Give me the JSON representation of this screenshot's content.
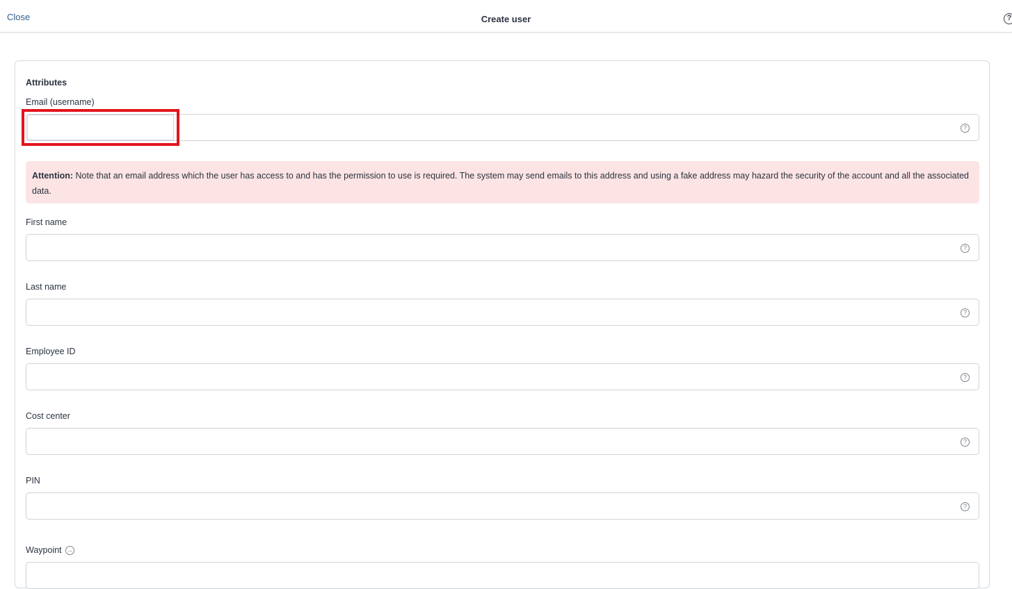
{
  "header": {
    "close_label": "Close",
    "title": "Create user",
    "help_icon": "question-circle-icon",
    "help_glyph": "?"
  },
  "form": {
    "section_title": "Attributes",
    "email": {
      "label": "Email (username)",
      "value": ""
    },
    "attention": {
      "prefix": "Attention:",
      "text": " Note that an email address which the user has access to and has the permission to use is required. The system may send emails to this address and using a fake address may hazard the security of the account and all the associated data."
    },
    "first_name": {
      "label": "First name",
      "value": ""
    },
    "last_name": {
      "label": "Last name",
      "value": ""
    },
    "employee_id": {
      "label": "Employee ID",
      "value": ""
    },
    "cost_center": {
      "label": "Cost center",
      "value": ""
    },
    "pin": {
      "label": "PIN",
      "value": ""
    },
    "waypoint": {
      "label": "Waypoint",
      "arrow_icon": "arrow-right-circle-icon",
      "arrow_glyph": "→"
    },
    "field_help_glyph": "?"
  },
  "colors": {
    "link": "#2f5d8a",
    "attention_bg": "#fde4e4",
    "highlight": "#e3141c"
  }
}
